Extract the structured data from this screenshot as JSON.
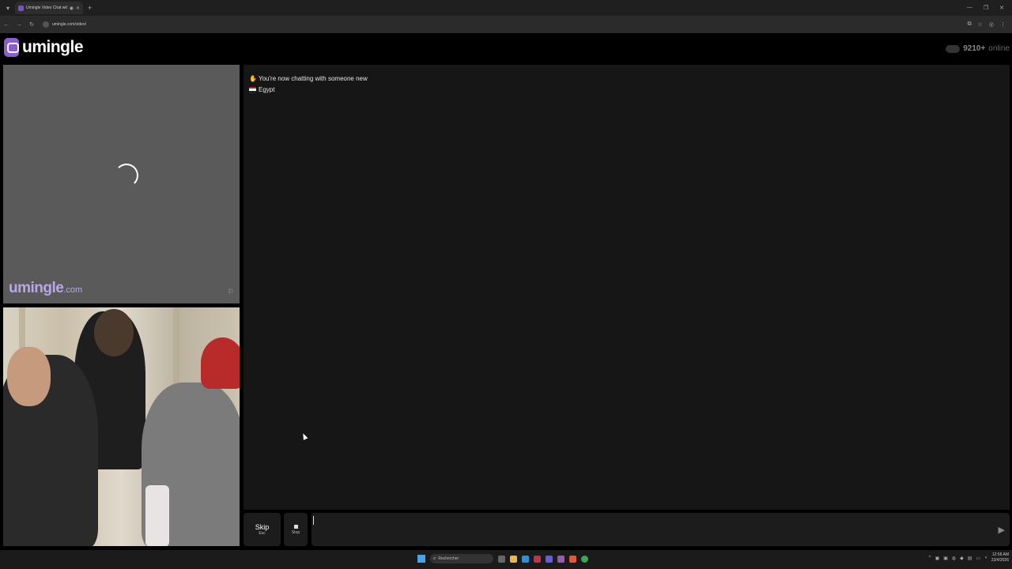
{
  "browser": {
    "tab_title": "Umingle Video Chat with S",
    "url": "umingle.com/video/"
  },
  "site": {
    "logo_text": "umingle",
    "online_count": "9210+",
    "online_label": "online"
  },
  "remote_video": {
    "watermark_main": "umingle",
    "watermark_domain": ".com"
  },
  "chat": {
    "messages": [
      {
        "text": "You're now chatting with someone new"
      },
      {
        "text": "Egypt"
      }
    ]
  },
  "controls": {
    "skip_label": "Skip",
    "skip_key": "Esc",
    "stop_label": "Stop",
    "message_value": ""
  },
  "taskbar": {
    "search_placeholder": "Rechercher",
    "time": "12:58 AM",
    "date": "23/4/2026"
  },
  "colors": {
    "brand": "#8a5cd6",
    "watermark": "#b9a6e8",
    "chat_bg": "#161616"
  }
}
